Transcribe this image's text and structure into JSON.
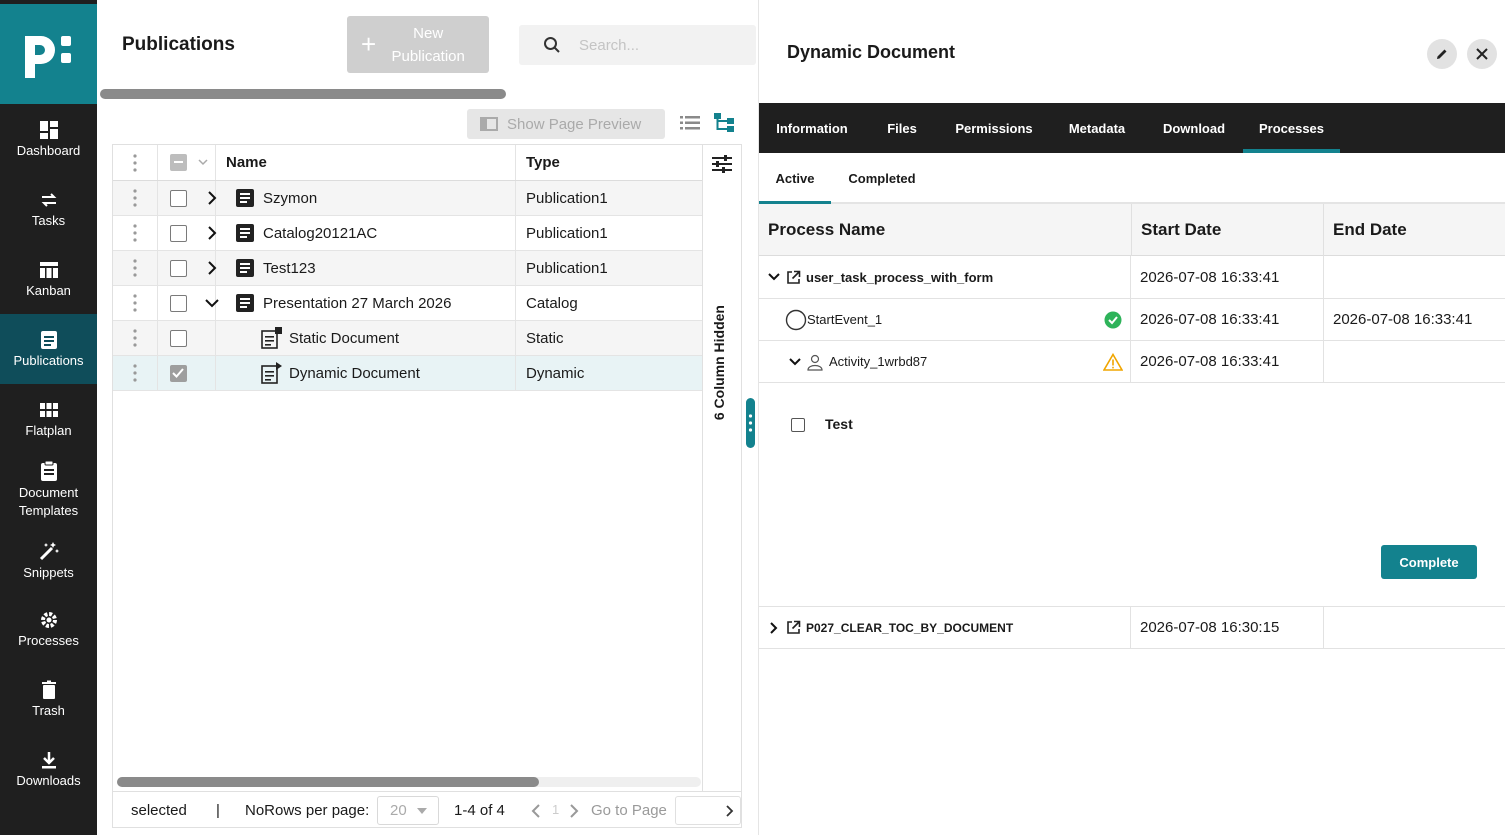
{
  "sidebar": {
    "items": [
      {
        "label": "Dashboard",
        "icon": "dashboard-icon"
      },
      {
        "label": "Tasks",
        "icon": "tasks-icon"
      },
      {
        "label": "Kanban",
        "icon": "kanban-icon"
      },
      {
        "label": "Publications",
        "icon": "publications-icon",
        "active": true
      },
      {
        "label": "Flatplan",
        "icon": "flatplan-icon"
      },
      {
        "label": "Document Templates",
        "icon": "document-templates-icon"
      },
      {
        "label": "Snippets",
        "icon": "snippets-icon"
      },
      {
        "label": "Processes",
        "icon": "processes-icon"
      },
      {
        "label": "Trash",
        "icon": "trash-icon"
      },
      {
        "label": "Downloads",
        "icon": "downloads-icon"
      }
    ]
  },
  "header": {
    "title": "Publications",
    "new_button": "New Publication",
    "search_placeholder": "Search..."
  },
  "toolbar": {
    "preview_label": "Show Page Preview"
  },
  "grid": {
    "columns": [
      "Name",
      "Type"
    ],
    "hidden_columns_label": "6 Column Hidden",
    "rows": [
      {
        "name": "Szymon",
        "type": "Publication1"
      },
      {
        "name": "Catalog20121AC",
        "type": "Publication1"
      },
      {
        "name": "Test123",
        "type": "Publication1"
      },
      {
        "name": "Presentation 27 March 2026",
        "type": "Catalog"
      },
      {
        "name": "Static Document",
        "type": "Static"
      },
      {
        "name": "Dynamic Document",
        "type": "Dynamic"
      }
    ],
    "footer": {
      "selected": "selected",
      "separator": "|",
      "rows_per_page_label": "NoRows per page:",
      "rows_per_page": "20",
      "range": "1-4 of 4",
      "page": "1",
      "go_to_page": "Go to Page"
    }
  },
  "details": {
    "title": "Dynamic Document",
    "tabs": [
      "Information",
      "Files",
      "Permissions",
      "Metadata",
      "Download",
      "Processes"
    ],
    "active_tab": "Processes",
    "subtabs": [
      "Active",
      "Completed"
    ],
    "process_table": {
      "headers": [
        "Process Name",
        "Start Date",
        "End Date"
      ],
      "rows": [
        {
          "name": "user_task_process_with_form",
          "start": "2026-07-08 16:33:41",
          "end": ""
        },
        {
          "name": "StartEvent_1",
          "start": "2026-07-08 16:33:41",
          "end": "2026-07-08 16:33:41"
        },
        {
          "name": "Activity_1wrbd87",
          "start": "2026-07-08 16:33:41",
          "end": ""
        },
        {
          "name": "P027_CLEAR_TOC_BY_DOCUMENT",
          "start": "2026-07-08 16:30:15",
          "end": ""
        }
      ],
      "form_checkbox_label": "Test",
      "complete_button": "Complete"
    }
  },
  "colors": {
    "accent": "#13828e",
    "sidebar_bg": "#1f1f1f",
    "success": "#2eb35a",
    "warning": "#f0a500"
  }
}
